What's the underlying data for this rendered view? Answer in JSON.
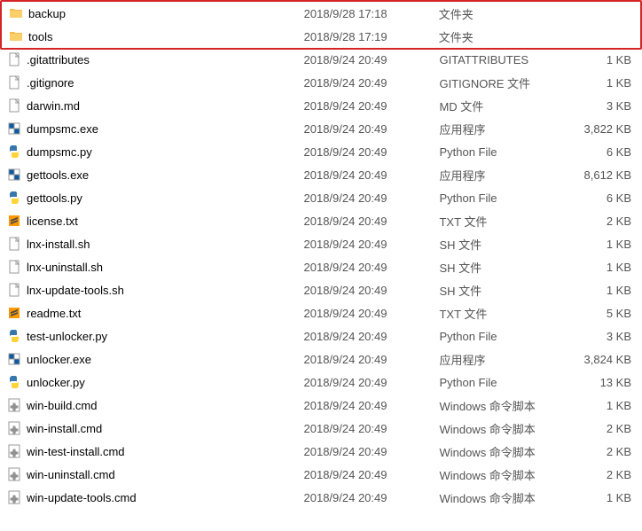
{
  "files": [
    {
      "name": "backup",
      "date": "2018/9/28 17:18",
      "type": "文件夹",
      "size": "",
      "icon": "folder",
      "hl": true
    },
    {
      "name": "tools",
      "date": "2018/9/28 17:19",
      "type": "文件夹",
      "size": "",
      "icon": "folder",
      "hl": true
    },
    {
      "name": ".gitattributes",
      "date": "2018/9/24 20:49",
      "type": "GITATTRIBUTES",
      "size": "1 KB",
      "icon": "file"
    },
    {
      "name": ".gitignore",
      "date": "2018/9/24 20:49",
      "type": "GITIGNORE 文件",
      "size": "1 KB",
      "icon": "file"
    },
    {
      "name": "darwin.md",
      "date": "2018/9/24 20:49",
      "type": "MD 文件",
      "size": "3 KB",
      "icon": "md"
    },
    {
      "name": "dumpsmc.exe",
      "date": "2018/9/24 20:49",
      "type": "应用程序",
      "size": "3,822 KB",
      "icon": "exe"
    },
    {
      "name": "dumpsmc.py",
      "date": "2018/9/24 20:49",
      "type": "Python File",
      "size": "6 KB",
      "icon": "py"
    },
    {
      "name": "gettools.exe",
      "date": "2018/9/24 20:49",
      "type": "应用程序",
      "size": "8,612 KB",
      "icon": "exe"
    },
    {
      "name": "gettools.py",
      "date": "2018/9/24 20:49",
      "type": "Python File",
      "size": "6 KB",
      "icon": "py"
    },
    {
      "name": "license.txt",
      "date": "2018/9/24 20:49",
      "type": "TXT 文件",
      "size": "2 KB",
      "icon": "subl"
    },
    {
      "name": "lnx-install.sh",
      "date": "2018/9/24 20:49",
      "type": "SH 文件",
      "size": "1 KB",
      "icon": "sh"
    },
    {
      "name": "lnx-uninstall.sh",
      "date": "2018/9/24 20:49",
      "type": "SH 文件",
      "size": "1 KB",
      "icon": "sh"
    },
    {
      "name": "lnx-update-tools.sh",
      "date": "2018/9/24 20:49",
      "type": "SH 文件",
      "size": "1 KB",
      "icon": "sh"
    },
    {
      "name": "readme.txt",
      "date": "2018/9/24 20:49",
      "type": "TXT 文件",
      "size": "5 KB",
      "icon": "subl"
    },
    {
      "name": "test-unlocker.py",
      "date": "2018/9/24 20:49",
      "type": "Python File",
      "size": "3 KB",
      "icon": "py"
    },
    {
      "name": "unlocker.exe",
      "date": "2018/9/24 20:49",
      "type": "应用程序",
      "size": "3,824 KB",
      "icon": "exe"
    },
    {
      "name": "unlocker.py",
      "date": "2018/9/24 20:49",
      "type": "Python File",
      "size": "13 KB",
      "icon": "py"
    },
    {
      "name": "win-build.cmd",
      "date": "2018/9/24 20:49",
      "type": "Windows 命令脚本",
      "size": "1 KB",
      "icon": "cmd"
    },
    {
      "name": "win-install.cmd",
      "date": "2018/9/24 20:49",
      "type": "Windows 命令脚本",
      "size": "2 KB",
      "icon": "cmd"
    },
    {
      "name": "win-test-install.cmd",
      "date": "2018/9/24 20:49",
      "type": "Windows 命令脚本",
      "size": "2 KB",
      "icon": "cmd"
    },
    {
      "name": "win-uninstall.cmd",
      "date": "2018/9/24 20:49",
      "type": "Windows 命令脚本",
      "size": "2 KB",
      "icon": "cmd"
    },
    {
      "name": "win-update-tools.cmd",
      "date": "2018/9/24 20:49",
      "type": "Windows 命令脚本",
      "size": "1 KB",
      "icon": "cmd"
    }
  ]
}
